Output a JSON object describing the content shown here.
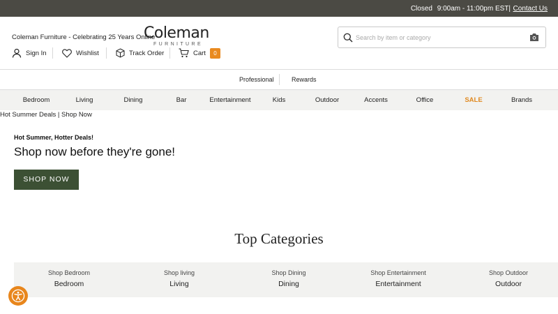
{
  "topbar": {
    "status": "Closed",
    "hours": "9:00am - 11:00pm EST|",
    "contact": "Contact Us"
  },
  "header": {
    "tagline": "Coleman Furniture - Celebrating 25 Years Online",
    "logo_word": "Coleman",
    "logo_sub": "FURNITURE",
    "sign_in": "Sign In",
    "wishlist": "Wishlist",
    "track_order": "Track Order",
    "cart": "Cart",
    "cart_count": "0",
    "search_placeholder": "Search by item or category"
  },
  "subnav": {
    "professional": "Professional",
    "rewards": "Rewards"
  },
  "categories_nav": [
    "Bedroom",
    "Living",
    "Dining",
    "Bar",
    "Entertainment",
    "Kids",
    "Outdoor",
    "Accents",
    "Office",
    "SALE",
    "Brands"
  ],
  "breadcrumb": "Hot Summer Deals | Shop Now",
  "promo": {
    "small": "Hot Summer, Hotter Deals!",
    "headline": "Shop now before they're gone!",
    "button": "SHOP NOW"
  },
  "top_categories": {
    "title": "Top Categories",
    "items": [
      {
        "small": "Shop Bedroom",
        "big": "Bedroom"
      },
      {
        "small": "Shop living",
        "big": "Living"
      },
      {
        "small": "Shop Dining",
        "big": "Dining"
      },
      {
        "small": "Shop Entertainment",
        "big": "Entertainment"
      },
      {
        "small": "Shop Outdoor",
        "big": "Outdoor"
      }
    ]
  },
  "colors": {
    "topbar": "#4b4a44",
    "accent": "#e98a1f",
    "button": "#3c5034"
  },
  "icons": [
    "user-icon",
    "heart-icon",
    "box-icon",
    "cart-icon",
    "search-icon",
    "camera-icon",
    "accessibility-icon"
  ]
}
